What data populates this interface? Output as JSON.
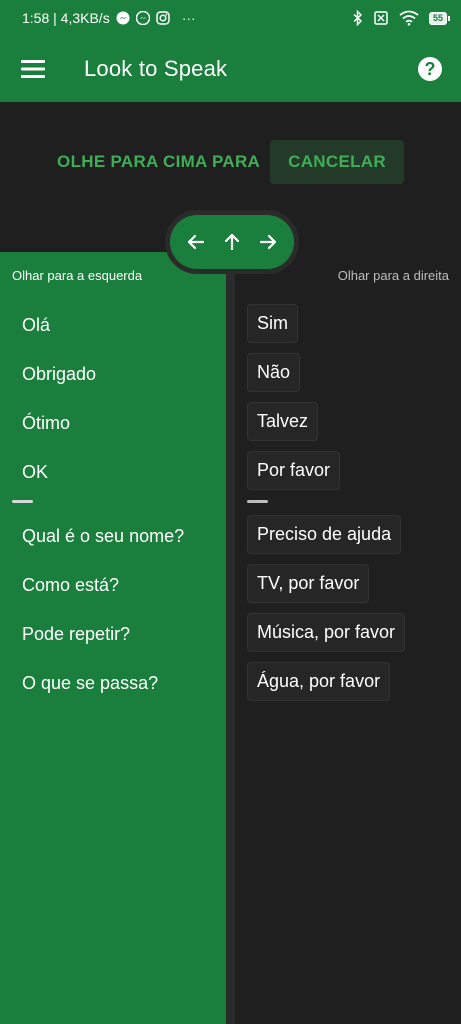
{
  "status": {
    "time_speed": "1:58 | 4,3KB/s",
    "dots": "···",
    "battery": "55"
  },
  "app_bar": {
    "title": "Look to Speak",
    "help_label": "?"
  },
  "prompt": {
    "text": "OLHE PARA CIMA PARA",
    "cancel_label": "CANCELAR"
  },
  "left_panel": {
    "caption": "Olhar para a esquerda",
    "items": [
      "Olá",
      "Obrigado",
      "Ótimo",
      "OK",
      "Qual é o seu nome?",
      "Como está?",
      "Pode repetir?",
      "O que se passa?"
    ]
  },
  "right_panel": {
    "caption": "Olhar para a direita",
    "items": [
      "Sim",
      "Não",
      "Talvez",
      "Por favor",
      "Preciso de ajuda",
      "TV, por favor",
      "Música, por favor",
      "Água, por favor"
    ]
  },
  "colors": {
    "primary_green": "#1a7f3c",
    "accent_green": "#3fae57",
    "background": "#1f1f1f"
  }
}
